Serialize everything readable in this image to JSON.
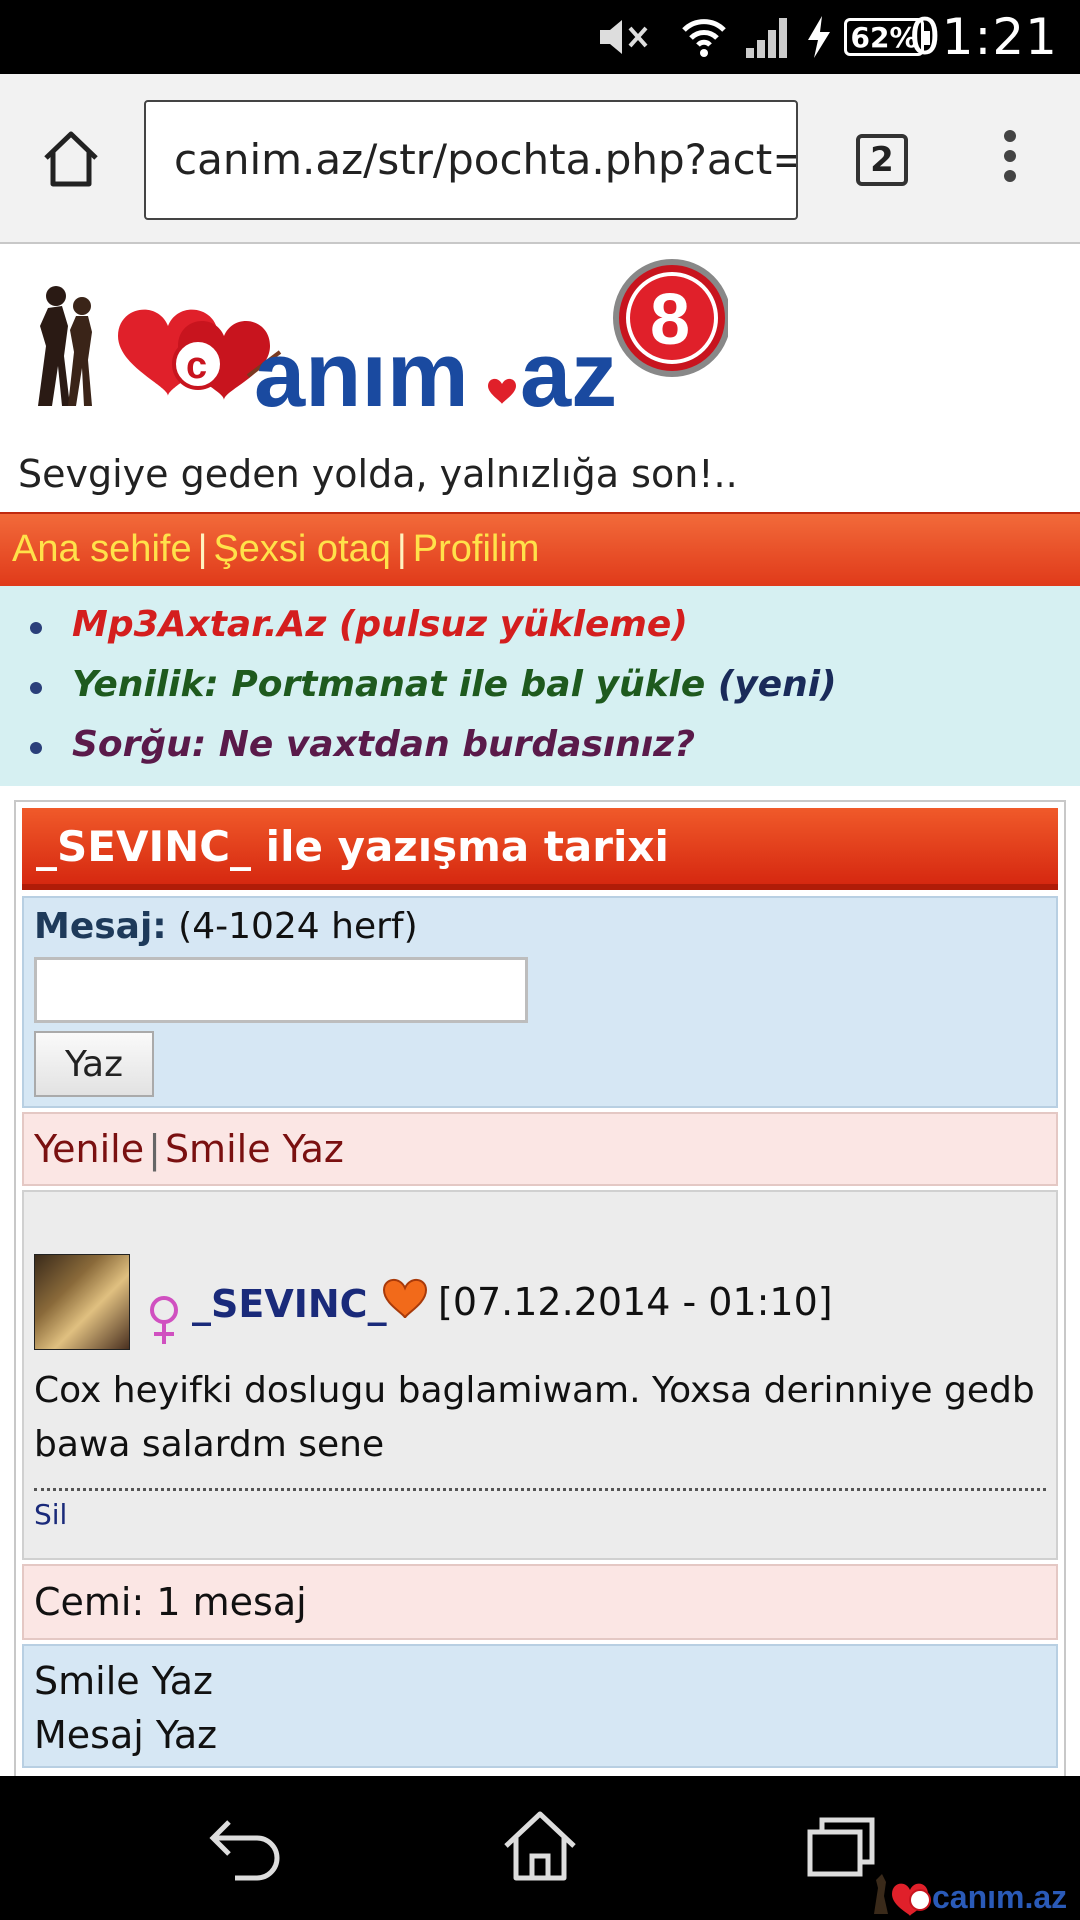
{
  "status_bar": {
    "battery": "62%",
    "time": "01:21"
  },
  "browser": {
    "url": "canim.az/str/pochta.php?act=l",
    "tab_count": "2"
  },
  "site": {
    "logo_text": "canım.az",
    "logo_badge": "8",
    "slogan": "Sevgiye geden yolda, yalnızlığa son!.."
  },
  "nav": {
    "items": [
      "Ana sehife",
      "Şexsi otaq",
      "Profilim"
    ],
    "separator": "|"
  },
  "notices": [
    {
      "text": "Mp3Axtar.Az (pulsuz yükleme)"
    },
    {
      "text": "Yenilik: Portmanat ile bal yükle",
      "tag": "(yeni)"
    },
    {
      "text": "Sorğu: Ne vaxtdan burdasınız?"
    }
  ],
  "conversation": {
    "title": "_SEVINC_ ile yazışma tarixi",
    "form": {
      "label": "Mesaj:",
      "hint": "(4-1024 herf)",
      "input_value": "",
      "submit_label": "Yaz"
    },
    "actions": {
      "refresh": "Yenile",
      "smile": "Smile Yaz",
      "separator": "|"
    },
    "messages": [
      {
        "sender": "_SEVINC_",
        "date": "[07.12.2014 - 01:10]",
        "text": "Cox heyifki doslugu baglamiwam. Yoxsa derinniye gedb bawa salardm sene",
        "delete_label": "Sil"
      }
    ],
    "total": "Cemi: 1 mesaj",
    "bottom_links": [
      "Smile Yaz",
      "Mesaj Yaz"
    ]
  },
  "watermark": "canım.az",
  "colors": {
    "nav_bar": "#e03a1a",
    "nav_text": "#ffe24a",
    "notice_bg": "#d6f0f2",
    "form_bg": "#d6e7f4",
    "pink_bg": "#fbe6e4",
    "title_bar": "#d62810",
    "sender_color": "#1a2a7a"
  },
  "icons": [
    "mute-icon",
    "wifi-icon",
    "signal-icon",
    "charging-icon",
    "home-icon",
    "tabs-icon",
    "overflow-menu-icon",
    "female-icon",
    "heart-icon",
    "back-icon",
    "recent-apps-icon"
  ]
}
